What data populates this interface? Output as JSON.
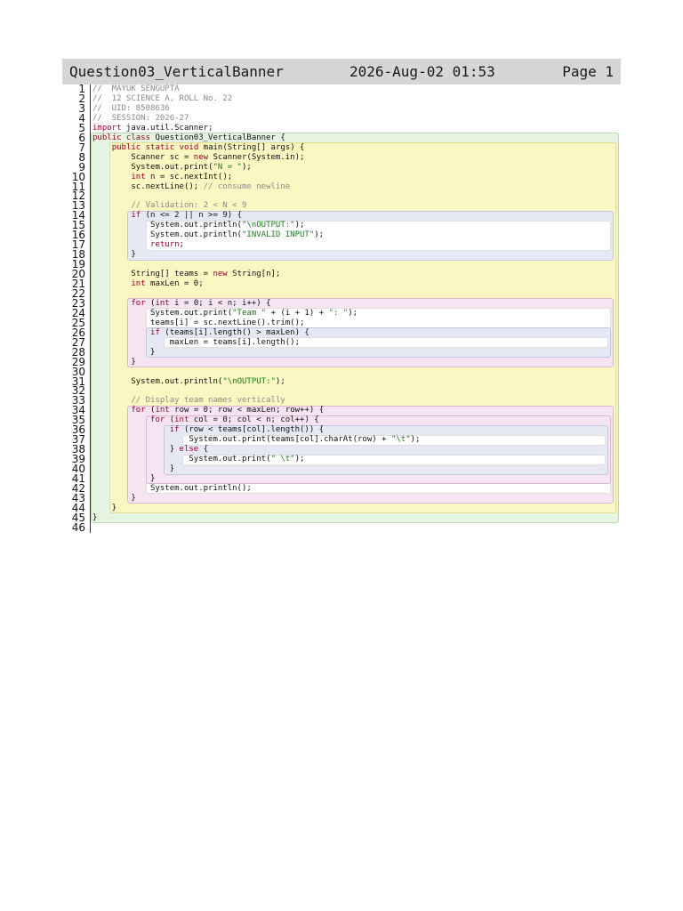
{
  "header": {
    "filename": "Question03_VerticalBanner",
    "datetime": "2026-Aug-02 01:53",
    "page": "Page 1"
  },
  "code_lines": [
    "//  MAYUK SENGUPTA",
    "//  12 SCIENCE A, ROLL No. 22",
    "//  UID: 8508636",
    "//  SESSION: 2026-27",
    "import java.util.Scanner;",
    "public class Question03_VerticalBanner {",
    "    public static void main(String[] args) {",
    "        Scanner sc = new Scanner(System.in);",
    "        System.out.print(\"N = \");",
    "        int n = sc.nextInt();",
    "        sc.nextLine(); // consume newline",
    "",
    "        // Validation: 2 < N < 9",
    "        if (n <= 2 || n >= 9) {",
    "            System.out.println(\"\\nOUTPUT:\");",
    "            System.out.println(\"INVALID INPUT\");",
    "            return;",
    "        }",
    "",
    "        String[] teams = new String[n];",
    "        int maxLen = 0;",
    "",
    "        for (int i = 0; i < n; i++) {",
    "            System.out.print(\"Team \" + (i + 1) + \": \");",
    "            teams[i] = sc.nextLine().trim();",
    "            if (teams[i].length() > maxLen) {",
    "                maxLen = teams[i].length();",
    "            }",
    "        }",
    "",
    "        System.out.println(\"\\nOUTPUT:\");",
    "",
    "        // Display team names vertically",
    "        for (int row = 0; row < maxLen; row++) {",
    "            for (int col = 0; col < n; col++) {",
    "                if (row < teams[col].length()) {",
    "                    System.out.print(teams[col].charAt(row) + \"\\t\");",
    "                } else {",
    "                    System.out.print(\" \\t\");",
    "                }",
    "            }",
    "            System.out.println();",
    "        }",
    "    }",
    "}",
    ""
  ]
}
